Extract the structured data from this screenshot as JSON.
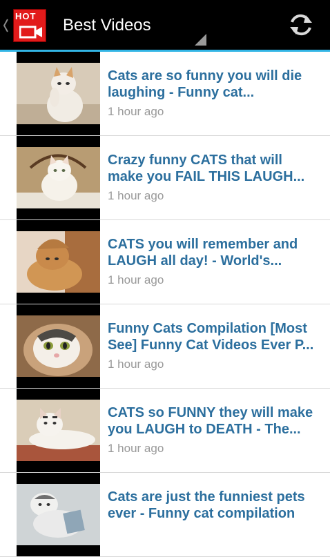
{
  "app": {
    "title": "Best Videos",
    "logo_text": "HOT"
  },
  "colors": {
    "actionbar": "#000000",
    "accent": "#33b5e5",
    "title_link": "#2c6f9e",
    "timestamp": "#999999",
    "logo_red": "#e21b1b"
  },
  "icons": {
    "up": "chevron-left-icon",
    "refresh": "refresh-icon"
  },
  "videos": [
    {
      "title": "Cats are so funny you will die laughing - Funny cat...",
      "time": "1 hour ago"
    },
    {
      "title": "Crazy funny CATS that will make you FAIL THIS LAUGH...",
      "time": "1 hour ago"
    },
    {
      "title": "CATS you will remember and LAUGH all day! - World's...",
      "time": "1 hour ago"
    },
    {
      "title": "Funny Cats Compilation [Most See] Funny Cat Videos Ever P...",
      "time": "1 hour ago"
    },
    {
      "title": "CATS so FUNNY they will make you LAUGH to DEATH - The...",
      "time": "1 hour ago"
    },
    {
      "title": "Cats are just the funniest pets ever - Funny cat compilation",
      "time": ""
    }
  ]
}
